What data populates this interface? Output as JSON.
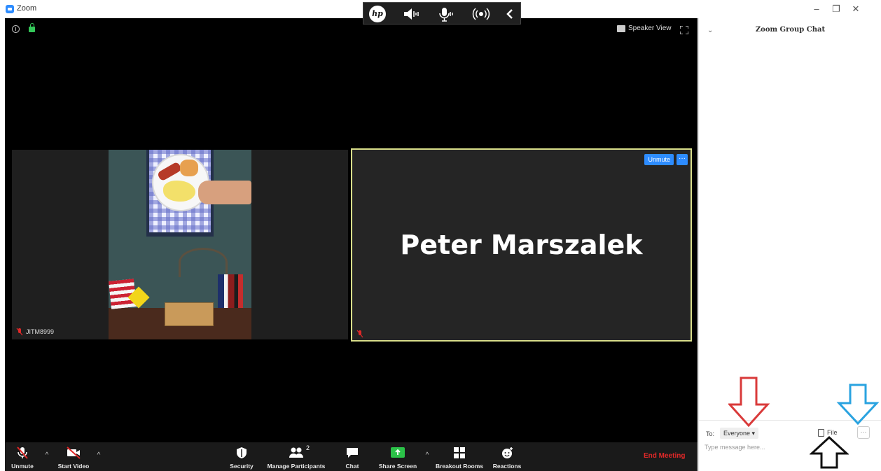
{
  "window": {
    "title": "Zoom",
    "minimize": "–",
    "restore": "❐",
    "close": "✕"
  },
  "meeting_top": {
    "speaker_view_label": "Speaker View"
  },
  "tiles": {
    "left": {
      "name": "JITM8999"
    },
    "right": {
      "name": "Peter Marszalek",
      "unmute_label": "Unmute",
      "more_label": "···"
    }
  },
  "toolbar": {
    "unmute": "Unmute",
    "start_video": "Start Video",
    "security": "Security",
    "manage_participants": "Manage Participants",
    "participant_count": "2",
    "chat": "Chat",
    "share_screen": "Share Screen",
    "breakout_rooms": "Breakout Rooms",
    "reactions": "Reactions",
    "end_meeting": "End Meeting",
    "caret": "^"
  },
  "chat": {
    "title": "Zoom Group Chat",
    "collapse": "⌄",
    "to_label": "To:",
    "to_value": "Everyone ▾",
    "file_label": "File",
    "more_label": "···",
    "message_placeholder": "Type message here..."
  },
  "colors": {
    "accent": "#2d8cff",
    "end_meeting": "#e02828",
    "active_speaker_border": "#d9de8a",
    "share_green": "#2bc248",
    "annotation_red": "#d93a3a",
    "annotation_blue": "#2aa3e0",
    "annotation_black": "#111111"
  },
  "icons": [
    "zoom-logo-icon",
    "hp-logo-icon",
    "speaker-icon",
    "microphone-icon",
    "broadcast-icon",
    "chevron-left-icon",
    "info-icon",
    "lock-icon",
    "speaker-view-icon",
    "fullscreen-icon",
    "muted-mic-icon",
    "video-off-icon",
    "shield-icon",
    "participants-icon",
    "chat-bubble-icon",
    "share-screen-icon",
    "breakout-rooms-icon",
    "reactions-icon",
    "file-icon"
  ]
}
